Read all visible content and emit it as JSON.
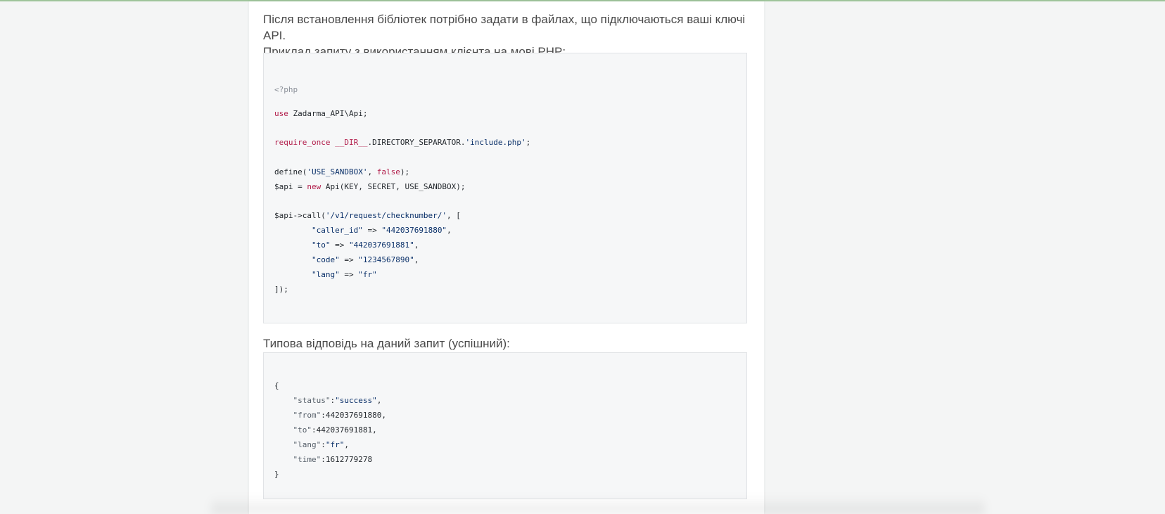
{
  "intro": {
    "line1": "Після встановлення бібліотек потрібно задати в файлах, що підключаються ваші ключі API.",
    "line2": "Приклад запиту з використанням клієнта на мові PHP:"
  },
  "request_code": {
    "php_open": "<?php",
    "use_kw": "use",
    "use_ns": " Zadarma_API\\Api;",
    "require_kw": "require_once",
    "require_dir": " __DIR__",
    "require_rest": ".DIRECTORY_SEPARATOR.",
    "require_str": "'include.php'",
    "require_end": ";",
    "define_fn": "define(",
    "define_str": "'USE_SANDBOX'",
    "define_comma": ", ",
    "define_false": "false",
    "define_end": ");",
    "api_var": "$api = ",
    "api_new": "new",
    "api_rest": " Api(KEY, SECRET, USE_SANDBOX);",
    "call_head": "$api->call(",
    "call_str": "'/v1/request/checknumber/'",
    "call_tail": ", [",
    "caller_key": "        \"caller_id\"",
    "caller_arrow": " => ",
    "caller_val": "\"442037691880\"",
    "caller_end": ",",
    "to_key": "        \"to\"",
    "to_arrow": " => ",
    "to_val": "\"442037691881\"",
    "to_end": ",",
    "code_key": "        \"code\"",
    "code_arrow": " => ",
    "code_val": "\"1234567890\"",
    "code_end": ",",
    "lang_key": "        \"lang\"",
    "lang_arrow": " => ",
    "lang_val": "\"fr\"",
    "close": "]);"
  },
  "response_title": "Типова відповідь на даний запит (успішний):",
  "response_code": {
    "open": "{",
    "status_key": "    \"status\"",
    "status_colon": ":",
    "status_val": "\"success\"",
    "status_end": ",",
    "from_key": "    \"from\"",
    "from_rest": ":442037691880,",
    "to_key": "    \"to\"",
    "to_rest": ":442037691881,",
    "lang_key": "    \"lang\"",
    "lang_colon": ":",
    "lang_val": "\"fr\"",
    "lang_end": ",",
    "time_key": "    \"time\"",
    "time_rest": ":1612779278",
    "close": "}"
  }
}
